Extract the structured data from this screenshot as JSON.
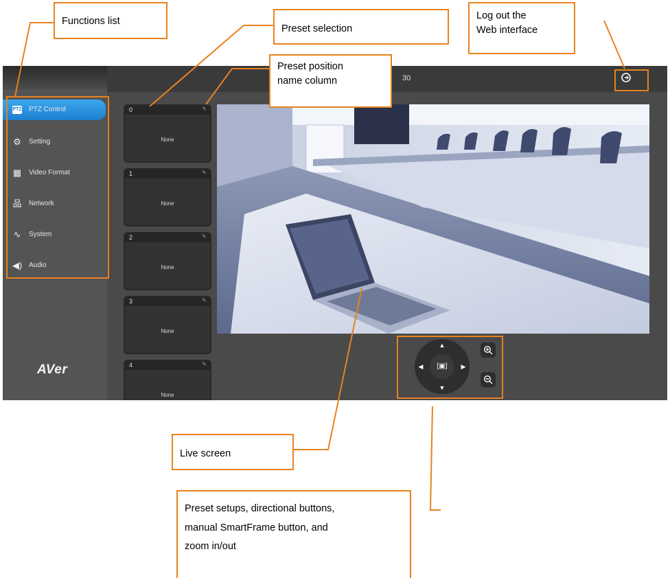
{
  "header": {
    "camera_name": "30",
    "logout_icon": "logout-icon"
  },
  "sidebar": {
    "logo": "AVer",
    "items": [
      {
        "label": "PTZ Control",
        "icon": "PTZ",
        "active": true
      },
      {
        "label": "Setting",
        "icon": "gear-icon"
      },
      {
        "label": "Video Format",
        "icon": "film-icon"
      },
      {
        "label": "Network",
        "icon": "network-icon"
      },
      {
        "label": "System",
        "icon": "pulse-icon"
      },
      {
        "label": "Audio",
        "icon": "speaker-icon"
      }
    ]
  },
  "presets": [
    {
      "number": "0",
      "name": "None"
    },
    {
      "number": "1",
      "name": "None"
    },
    {
      "number": "2",
      "name": "None"
    },
    {
      "number": "3",
      "name": "None"
    },
    {
      "number": "4",
      "name": "None"
    }
  ],
  "callouts": {
    "functions_list": "Functions list",
    "preset_selection": "Preset selection",
    "preset_name_line1": "Preset position",
    "preset_name_line2": "name column",
    "logout_line1": "Log out the",
    "logout_line2": "Web interface",
    "live_screen": "Live screen",
    "setups_line1": "Preset setups, directional buttons,",
    "setups_line2": "manual SmartFrame button, and",
    "setups_line3": "zoom in/out"
  },
  "colors": {
    "accent": "#e8821e",
    "active_nav": "#1c7fd0",
    "app_bg": "#4a4a4a"
  }
}
